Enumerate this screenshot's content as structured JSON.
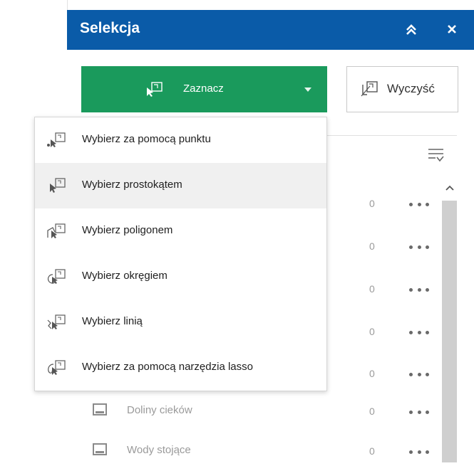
{
  "panel": {
    "title": "Selekcja",
    "header_color": "#0a5ba8",
    "collapse_icon": "double-chevron-up-icon",
    "close_icon": "close-icon"
  },
  "toolbar": {
    "select_label": "Zaznacz",
    "select_color": "#1a9a5c",
    "clear_label": "Wyczyść"
  },
  "dropdown": {
    "items": [
      {
        "label": "Wybierz za pomocą punktu",
        "icon": "select-point-icon"
      },
      {
        "label": "Wybierz prostokątem",
        "icon": "select-rectangle-icon",
        "active": true
      },
      {
        "label": "Wybierz poligonem",
        "icon": "select-polygon-icon"
      },
      {
        "label": "Wybierz okręgiem",
        "icon": "select-circle-icon"
      },
      {
        "label": "Wybierz linią",
        "icon": "select-line-icon"
      },
      {
        "label": "Wybierz za pomocą narzędzia lasso",
        "icon": "select-lasso-icon"
      }
    ]
  },
  "layers": {
    "rows": [
      {
        "label": "",
        "count": "0"
      },
      {
        "label": "",
        "count": "0"
      },
      {
        "label": "",
        "count": "0"
      },
      {
        "label": "",
        "count": "0"
      },
      {
        "label": "",
        "count": "0"
      },
      {
        "label": "Doliny cieków",
        "count": "0"
      },
      {
        "label": "Wody stojące",
        "count": "0"
      }
    ]
  }
}
